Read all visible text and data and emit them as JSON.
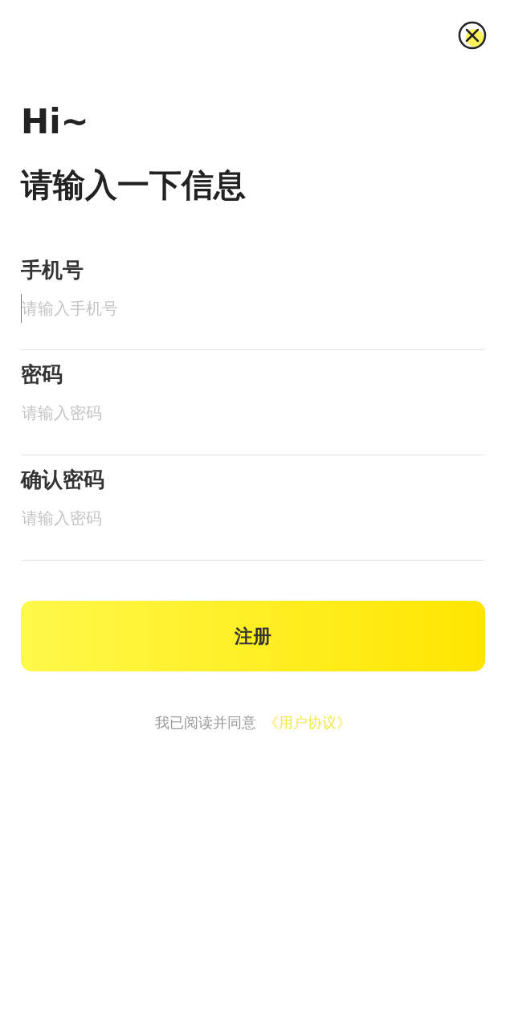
{
  "greeting": "Hi~",
  "heading": "请输入一下信息",
  "fields": [
    {
      "label": "手机号",
      "placeholder": "请输入手机号",
      "focused": true
    },
    {
      "label": "密码",
      "placeholder": "请输入密码",
      "focused": false
    },
    {
      "label": "确认密码",
      "placeholder": "请输入密码",
      "focused": false
    }
  ],
  "submit": "注册",
  "agreement": {
    "text": "我已阅读并同意",
    "link": "《用户协议》"
  }
}
